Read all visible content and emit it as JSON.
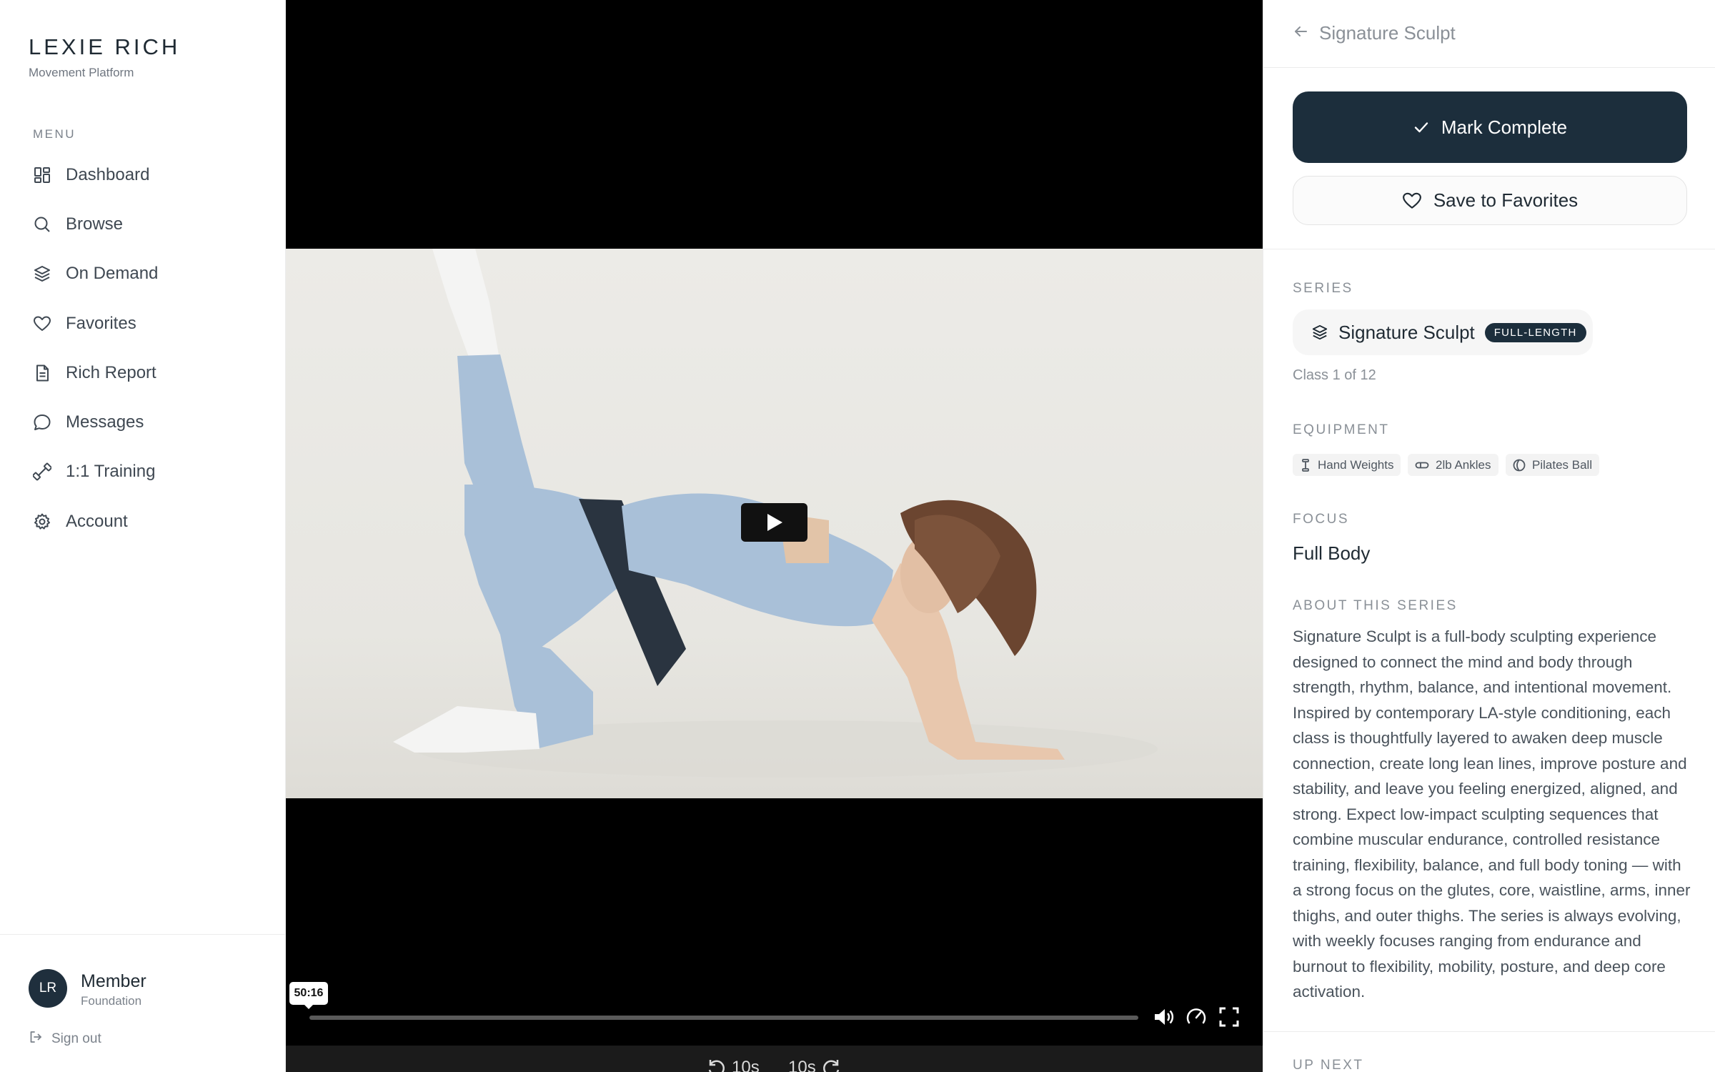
{
  "brand": {
    "name": "LEXIE RICH",
    "subtitle": "Movement Platform"
  },
  "sidebar": {
    "menu_label": "MENU",
    "items": [
      {
        "label": "Dashboard",
        "icon": "dashboard-icon"
      },
      {
        "label": "Browse",
        "icon": "search-icon"
      },
      {
        "label": "On Demand",
        "icon": "layers-icon"
      },
      {
        "label": "Favorites",
        "icon": "heart-icon"
      },
      {
        "label": "Rich Report",
        "icon": "document-icon"
      },
      {
        "label": "Messages",
        "icon": "message-icon"
      },
      {
        "label": "1:1 Training",
        "icon": "dumbbell-icon"
      },
      {
        "label": "Account",
        "icon": "gear-icon"
      }
    ],
    "user": {
      "initials": "LR",
      "name": "Member",
      "tier": "Foundation"
    },
    "signout_label": "Sign out"
  },
  "video": {
    "time_tooltip": "50:16",
    "progress": 0.0,
    "skip_back_label": "10s",
    "skip_forward_label": "10s"
  },
  "panel": {
    "header_title": "Signature Sculpt",
    "mark_complete_label": "Mark Complete",
    "save_favorites_label": "Save to Favorites",
    "series_label": "SERIES",
    "series_name": "Signature Sculpt",
    "series_badge": "FULL-LENGTH",
    "class_count": "Class 1 of 12",
    "equipment_label": "EQUIPMENT",
    "equipment": [
      {
        "label": "Hand Weights",
        "icon": "hand-weight-icon"
      },
      {
        "label": "2lb Ankles",
        "icon": "ankle-weight-icon"
      },
      {
        "label": "Pilates Ball",
        "icon": "ball-icon"
      }
    ],
    "focus_label": "FOCUS",
    "focus_value": "Full Body",
    "about_label": "ABOUT THIS SERIES",
    "about_text": "Signature Sculpt is a full-body sculpting experience designed to connect the mind and body through strength, rhythm, balance, and intentional movement. Inspired by contemporary LA-style conditioning, each class is thoughtfully layered to awaken deep muscle connection, create long lean lines, improve posture and stability, and leave you feeling energized, aligned, and strong. Expect low-impact sculpting sequences that combine muscular endurance, controlled resistance training, flexibility, balance, and full body toning — with a strong focus on the glutes, core, waistline, arms, inner thighs, and outer thighs. The series is always evolving, with weekly focuses ranging from endurance and burnout to flexibility, mobility, posture, and deep core activation.",
    "up_next_label": "UP NEXT"
  },
  "colors": {
    "primary": "#1c2e3c",
    "muted_text": "#8a9097",
    "video_bg": "#000000"
  }
}
